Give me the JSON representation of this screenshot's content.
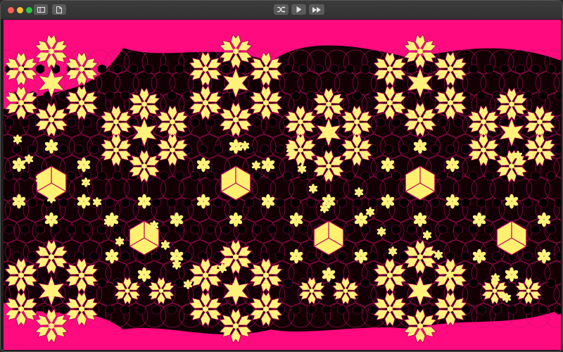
{
  "window": {
    "traffic_lights": [
      "close",
      "minimize",
      "zoom"
    ]
  },
  "toolbar": {
    "left_buttons": [
      {
        "name": "sidebar-toggle-button",
        "icon": "sidebar-icon"
      },
      {
        "name": "new-document-button",
        "icon": "document-icon"
      }
    ],
    "center_buttons": [
      {
        "name": "shuffle-button",
        "icon": "shuffle-icon"
      },
      {
        "name": "play-button",
        "icon": "play-icon"
      },
      {
        "name": "fast-forward-button",
        "icon": "fast-forward-icon"
      }
    ]
  },
  "tiling": {
    "background_color": "#ff0a7f",
    "field_color": "#130005",
    "line_color": "#c8106a",
    "flower_color": "#fff27a",
    "outline_color": "#b8005a",
    "hexagon_color": "#fff070",
    "motifs": [
      "snowflake-rosette",
      "six-point-star",
      "small-flower",
      "cube-hexagon",
      "black-hexagon"
    ]
  }
}
